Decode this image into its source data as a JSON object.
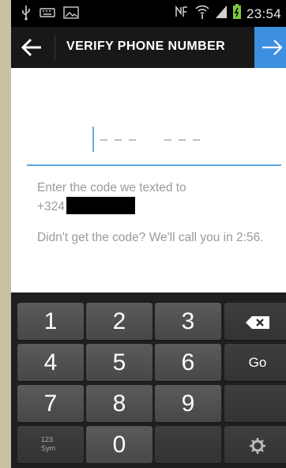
{
  "status_bar": {
    "time": "23:54",
    "icons": [
      "usb-icon",
      "keyboard-icon",
      "image-icon",
      "nfc-icon",
      "wifi-icon",
      "signal-icon",
      "battery-icon"
    ]
  },
  "app_bar": {
    "title": "VERIFY PHONE NUMBER",
    "back_icon": "arrow-left-icon",
    "next_icon": "arrow-right-icon",
    "next_color": "#3d8fe0"
  },
  "code_field": {
    "value": "",
    "accent": "#5aa5e0"
  },
  "message": {
    "line1": "Enter the code we texted to",
    "phone_prefix": "+324",
    "retry": "Didn't get the code? We'll call you in 2:56."
  },
  "keyboard": {
    "keys": [
      "1",
      "2",
      "3",
      "7",
      "4",
      "5",
      "6",
      "Go",
      "7",
      "8",
      "9",
      "123",
      "Sym",
      "0"
    ],
    "row1": [
      "1",
      "2",
      "3"
    ],
    "row2": [
      "4",
      "5",
      "6"
    ],
    "row3": [
      "7",
      "8",
      "9"
    ],
    "go_label": "Go",
    "sym_line1": "123",
    "sym_line2": "Sym",
    "zero": "0",
    "backspace_icon": "backspace-icon",
    "settings_icon": "gear-icon"
  }
}
